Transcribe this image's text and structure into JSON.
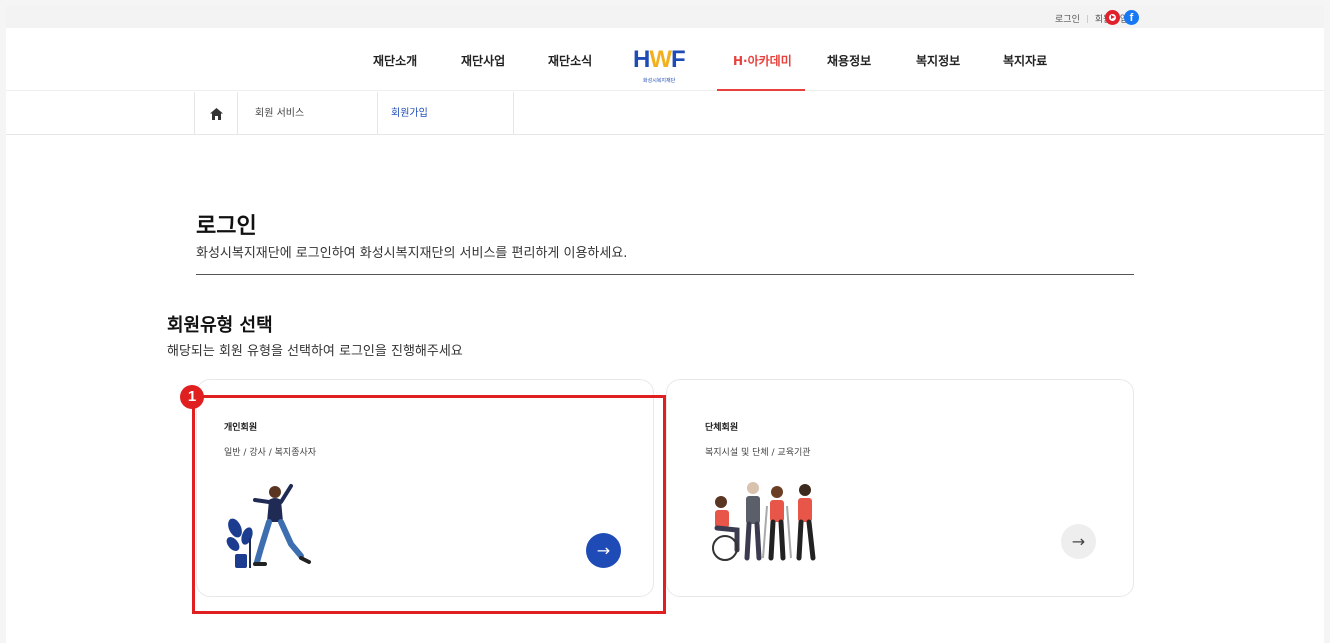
{
  "util": {
    "login": "로그인",
    "signup": "회원가입"
  },
  "icons": {
    "youtube": "youtube-icon",
    "facebook": "facebook-icon",
    "home": "home-icon",
    "arrow": "arrow-right-icon"
  },
  "colors": {
    "brand_blue": "#1e4bb6",
    "accent_red": "#e8403a",
    "brand_yellow": "#f2b01e",
    "highlight": "#e02020"
  },
  "nav": {
    "items": [
      "재단소개",
      "재단사업",
      "재단소식",
      "H·아카데미",
      "채용정보",
      "복지정보",
      "복지자료"
    ],
    "active": "H·아카데미",
    "logo_text": "HWF",
    "logo_sub": "화성시복지재단"
  },
  "breadcrumb": {
    "level1": "회원 서비스",
    "level2": "회원가입"
  },
  "page": {
    "title": "로그인",
    "subtitle": "화성시복지재단에 로그인하여 화성시복지재단의 서비스를 편리하게 이용하세요.",
    "section_title": "회원유형 선택",
    "section_sub": "해당되는 회원 유형을 선택하여 로그인을 진행해주세요"
  },
  "cards": [
    {
      "title": "개인회원",
      "desc": "일반 / 강사 / 복지종사자",
      "arrow": "→"
    },
    {
      "title": "단체회원",
      "desc": "복지시설 및 단체 / 교육기관",
      "arrow": "→"
    }
  ],
  "annotation": {
    "marker": "1"
  }
}
